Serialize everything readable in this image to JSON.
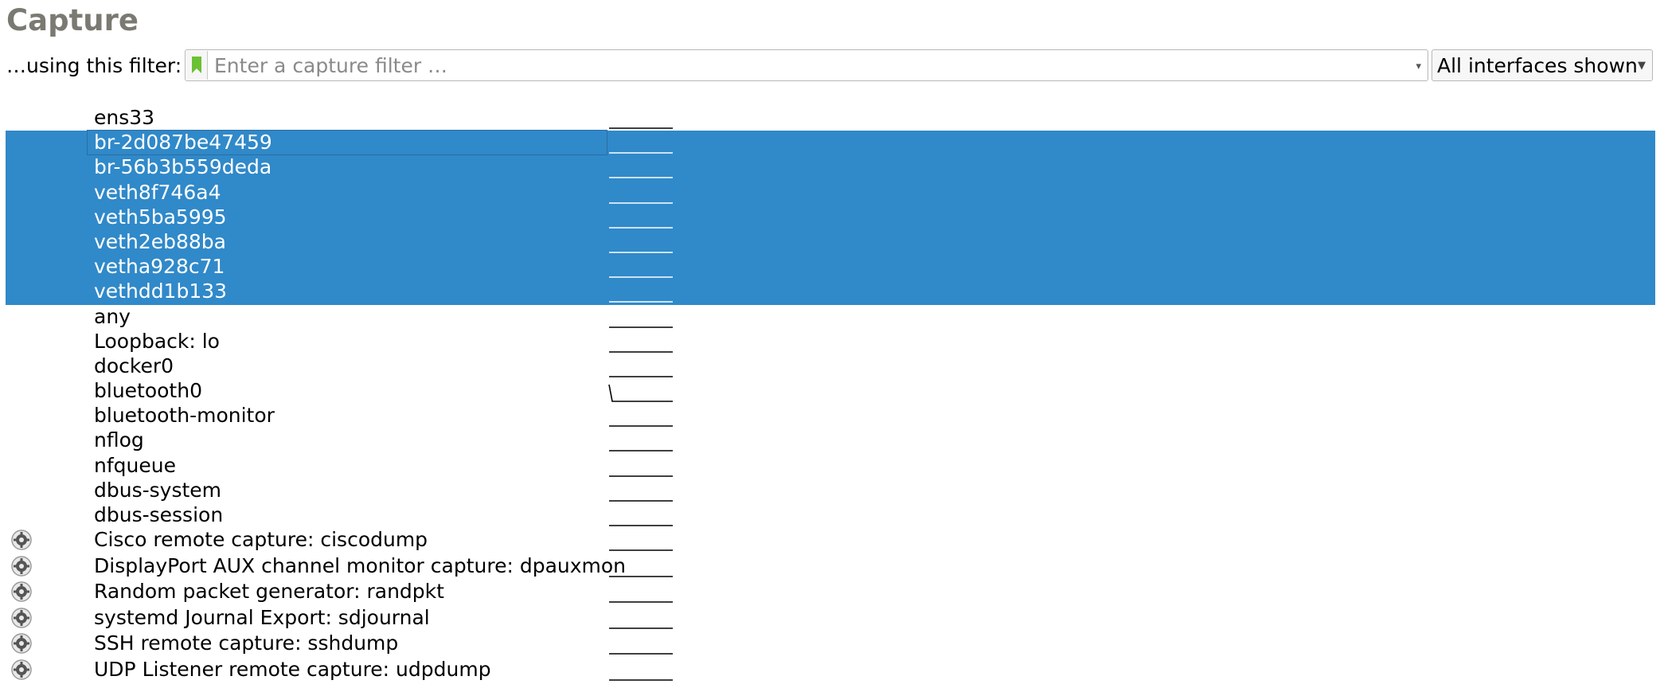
{
  "heading": "Capture",
  "filter": {
    "label": "…using this filter:",
    "placeholder": "Enter a capture filter …",
    "interfaces_dropdown": "All interfaces shown"
  },
  "colors": {
    "selection": "#3089c9",
    "bookmark_green": "#6ac132",
    "heading": "#7a7a72"
  },
  "interfaces": [
    {
      "name": "ens33",
      "selected": false,
      "extcap": false,
      "spike": false
    },
    {
      "name": "br-2d087be47459",
      "selected": true,
      "current": true,
      "extcap": false,
      "spike": false
    },
    {
      "name": "br-56b3b559deda",
      "selected": true,
      "extcap": false,
      "spike": false
    },
    {
      "name": "veth8f746a4",
      "selected": true,
      "extcap": false,
      "spike": false
    },
    {
      "name": "veth5ba5995",
      "selected": true,
      "extcap": false,
      "spike": false
    },
    {
      "name": "veth2eb88ba",
      "selected": true,
      "extcap": false,
      "spike": false
    },
    {
      "name": "vetha928c71",
      "selected": true,
      "extcap": false,
      "spike": false
    },
    {
      "name": "vethdd1b133",
      "selected": true,
      "extcap": false,
      "spike": false
    },
    {
      "name": "any",
      "selected": false,
      "extcap": false,
      "spike": false
    },
    {
      "name": "Loopback: lo",
      "selected": false,
      "extcap": false,
      "spike": false
    },
    {
      "name": "docker0",
      "selected": false,
      "extcap": false,
      "spike": false
    },
    {
      "name": "bluetooth0",
      "selected": false,
      "extcap": false,
      "spike": true
    },
    {
      "name": "bluetooth-monitor",
      "selected": false,
      "extcap": false,
      "spike": false
    },
    {
      "name": "nflog",
      "selected": false,
      "extcap": false,
      "spike": false
    },
    {
      "name": "nfqueue",
      "selected": false,
      "extcap": false,
      "spike": false
    },
    {
      "name": "dbus-system",
      "selected": false,
      "extcap": false,
      "spike": false
    },
    {
      "name": "dbus-session",
      "selected": false,
      "extcap": false,
      "spike": false
    },
    {
      "name": "Cisco remote capture: ciscodump",
      "selected": false,
      "extcap": true,
      "spike": false
    },
    {
      "name": "DisplayPort AUX channel monitor capture: dpauxmon",
      "selected": false,
      "extcap": true,
      "spike": false
    },
    {
      "name": "Random packet generator: randpkt",
      "selected": false,
      "extcap": true,
      "spike": false
    },
    {
      "name": "systemd Journal Export: sdjournal",
      "selected": false,
      "extcap": true,
      "spike": false
    },
    {
      "name": "SSH remote capture: sshdump",
      "selected": false,
      "extcap": true,
      "spike": false
    },
    {
      "name": "UDP Listener remote capture: udpdump",
      "selected": false,
      "extcap": true,
      "spike": false
    }
  ]
}
